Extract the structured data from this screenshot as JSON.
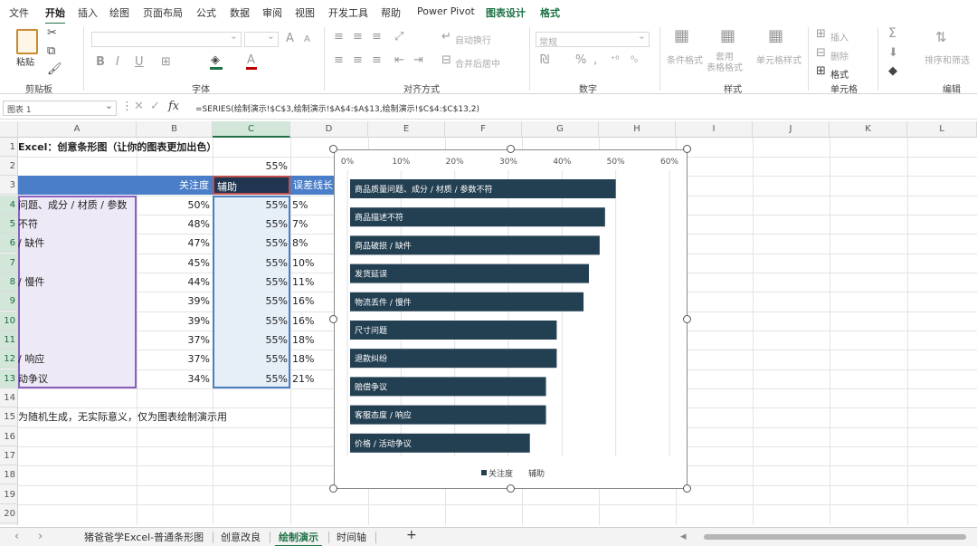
{
  "ribbon_tabs": [
    "文件",
    "开始",
    "插入",
    "绘图",
    "页面布局",
    "公式",
    "数据",
    "审阅",
    "视图",
    "开发工具",
    "帮助",
    "Power Pivot",
    "图表设计",
    "格式"
  ],
  "ribbon": {
    "paste_label": "粘贴",
    "groups": [
      "剪贴板",
      "字体",
      "对齐方式",
      "数字",
      "样式",
      "单元格",
      "编辑"
    ],
    "wrap_text": "自动换行",
    "merge_center": "合并后居中",
    "number_format": "常规",
    "conditional_format": "条件格式",
    "table_format": "套用\n表格格式",
    "cell_styles": "单元格样式",
    "insert": "插入",
    "delete": "删除",
    "format": "格式",
    "sort_filter": "排序和筛选",
    "font_btns": [
      "B",
      "I",
      "U"
    ],
    "font_size_up": "A",
    "font_size_down": "A"
  },
  "formula_bar": {
    "name_box": "图表 1",
    "fx": "fx",
    "formula": "=SERIES(绘制演示!$C$3,绘制演示!$A$4:$A$13,绘制演示!$C$4:$C$13,2)"
  },
  "columns": [
    "A",
    "B",
    "C",
    "D",
    "E",
    "F",
    "G",
    "H",
    "I",
    "J",
    "K",
    "L"
  ],
  "rows": [
    "1",
    "2",
    "3",
    "4",
    "5",
    "6",
    "7",
    "8",
    "9",
    "10",
    "11",
    "12",
    "13",
    "14",
    "15",
    "16",
    "17",
    "18",
    "19",
    "20"
  ],
  "sheet": {
    "title": "Excel：创意条形图（让你的图表更加出色）",
    "c2": "55%",
    "header": [
      "关注度",
      "辅助",
      "误差线长"
    ],
    "data": [
      {
        "a": "问题、成分 / 材质 / 参数",
        "b": "50%",
        "c": "55%",
        "d": "5%"
      },
      {
        "a": "不符",
        "b": "48%",
        "c": "55%",
        "d": "7%"
      },
      {
        "a": "/ 缺件",
        "b": "47%",
        "c": "55%",
        "d": "8%"
      },
      {
        "a": "",
        "b": "45%",
        "c": "55%",
        "d": "10%"
      },
      {
        "a": "/ 慢件",
        "b": "44%",
        "c": "55%",
        "d": "11%"
      },
      {
        "a": "",
        "b": "39%",
        "c": "55%",
        "d": "16%"
      },
      {
        "a": "",
        "b": "39%",
        "c": "55%",
        "d": "16%"
      },
      {
        "a": "",
        "b": "37%",
        "c": "55%",
        "d": "18%"
      },
      {
        "a": "/ 响应",
        "b": "37%",
        "c": "55%",
        "d": "18%"
      },
      {
        "a": "动争议",
        "b": "34%",
        "c": "55%",
        "d": "21%"
      }
    ],
    "note": "为随机生成，无实际意义，仅为图表绘制演示用"
  },
  "chart_data": {
    "type": "bar",
    "categories": [
      "商品质量问题、成分 / 材质 / 参数不符",
      "商品描述不符",
      "商品破损 / 缺件",
      "发货延误",
      "物流丢件 / 慢件",
      "尺寸问题",
      "退款纠纷",
      "赔偿争议",
      "客服态度 / 响应",
      "价格 / 活动争议"
    ],
    "values": [
      50,
      48,
      47,
      45,
      44,
      39,
      39,
      37,
      37,
      34
    ],
    "xticks": [
      "0%",
      "10%",
      "20%",
      "30%",
      "40%",
      "50%",
      "60%"
    ],
    "xlim": [
      0,
      60
    ],
    "legend": [
      "关注度",
      "辅助"
    ],
    "legend_position": "bottom",
    "bar_color": "#233f52"
  },
  "sheet_tabs": [
    "猪爸爸学Excel-普通条形图",
    "创意改良",
    "绘制演示",
    "时间轴"
  ],
  "sheet_tabs_active": 2,
  "add_sheet": "+"
}
